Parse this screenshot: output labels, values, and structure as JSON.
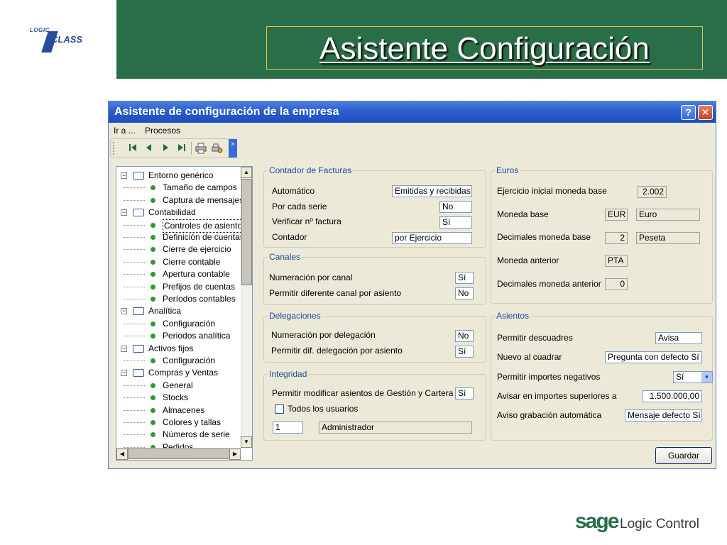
{
  "slide": {
    "title": "Asistente Configuración",
    "logo_small_top": "LOGIC",
    "logo_small_main": "CLASS",
    "footer_brand": "sage",
    "footer_product": "Logic Control"
  },
  "window": {
    "title": "Asistente de configuración de la empresa",
    "help_label": "?",
    "close_label": "✕",
    "menu": [
      "Ir a ...",
      "Procesos"
    ]
  },
  "toolbar": {
    "icons": [
      "first-record-icon",
      "previous-record-icon",
      "next-record-icon",
      "last-record-icon",
      "print-icon",
      "print-setup-icon"
    ],
    "more": "»"
  },
  "tree": {
    "items": [
      {
        "label": "Entorno genérico",
        "level": 0
      },
      {
        "label": "Tamaño de campos",
        "level": 1
      },
      {
        "label": "Captura de mensajes",
        "level": 1
      },
      {
        "label": "Contabilidad",
        "level": 0
      },
      {
        "label": "Controles de asiento",
        "level": 1,
        "selected": true
      },
      {
        "label": "Definición de cuentas",
        "level": 1
      },
      {
        "label": "Cierre de ejercicio",
        "level": 1
      },
      {
        "label": "Cierre contable",
        "level": 1
      },
      {
        "label": "Apertura contable",
        "level": 1
      },
      {
        "label": "Prefijos de cuentas",
        "level": 1
      },
      {
        "label": "Períodos contables",
        "level": 1
      },
      {
        "label": "Analítica",
        "level": 0
      },
      {
        "label": "Configuración",
        "level": 1
      },
      {
        "label": "Periodos analítica",
        "level": 1
      },
      {
        "label": "Activos fijos",
        "level": 0
      },
      {
        "label": "Configuración",
        "level": 1
      },
      {
        "label": "Compras y Ventas",
        "level": 0
      },
      {
        "label": "General",
        "level": 1
      },
      {
        "label": "Stocks",
        "level": 1
      },
      {
        "label": "Almacenes",
        "level": 1
      },
      {
        "label": "Colores y tallas",
        "level": 1
      },
      {
        "label": "Números de serie",
        "level": 1
      },
      {
        "label": "Pedidos",
        "level": 1
      }
    ]
  },
  "contador": {
    "title": "Contador de Facturas",
    "automatico_label": "Automático",
    "automatico_value": "Emitidas y recibidas",
    "serie_label": "Por cada serie",
    "serie_value": "No",
    "verificar_label": "Verificar nº factura",
    "verificar_value": "Sí",
    "contador_label": "Contador",
    "contador_value": "por Ejercicio"
  },
  "canales": {
    "title": "Canales",
    "numeracion_label": "Numeración por canal",
    "numeracion_value": "Sí",
    "permitir_label": "Permitir diferente canal por asiento",
    "permitir_value": "No"
  },
  "delegaciones": {
    "title": "Delegaciones",
    "numeracion_label": "Numeración por delegación",
    "numeracion_value": "No",
    "permitir_label": "Permitir dif. delegación por asiento",
    "permitir_value": "Sí"
  },
  "integridad": {
    "title": "Integridad",
    "permitir_label": "Permitir modificar asientos de Gestión y Cartera",
    "permitir_value": "Sí",
    "todos_label": "Todos los usuarios",
    "usuario_code": "1",
    "usuario_name": "Administrador"
  },
  "euros": {
    "title": "Euros",
    "ejercicio_label": "Ejercicio inicial moneda base",
    "ejercicio_value": "2.002",
    "moneda_label": "Moneda base",
    "moneda_code": "EUR",
    "moneda_name": "Euro",
    "decimales_label": "Decimales moneda base",
    "decimales_value": "2",
    "decimales_name": "Peseta",
    "anterior_label": "Moneda anterior",
    "anterior_value": "PTA",
    "dec_anterior_label": "Decimales moneda anterior",
    "dec_anterior_value": "0"
  },
  "asientos": {
    "title": "Asientos",
    "descuadres_label": "Permitir descuadres",
    "descuadres_value": "Avisa",
    "nuevo_label": "Nuevo al cuadrar",
    "nuevo_value": "Pregunta con defecto Sí",
    "negativos_label": "Permitir importes negativos",
    "negativos_value": "Sí",
    "avisar_label": "Avisar en importes superiores a",
    "avisar_value": "1.500.000,00",
    "aviso_label": "Aviso grabación automática",
    "aviso_value": "Mensaje defecto Sí"
  },
  "buttons": {
    "guardar": "Guardar"
  },
  "colors": {
    "banner_green": "#2a6e48",
    "titlebar_blue": "#2a5bc9",
    "group_title_blue": "#1c4a9c"
  }
}
